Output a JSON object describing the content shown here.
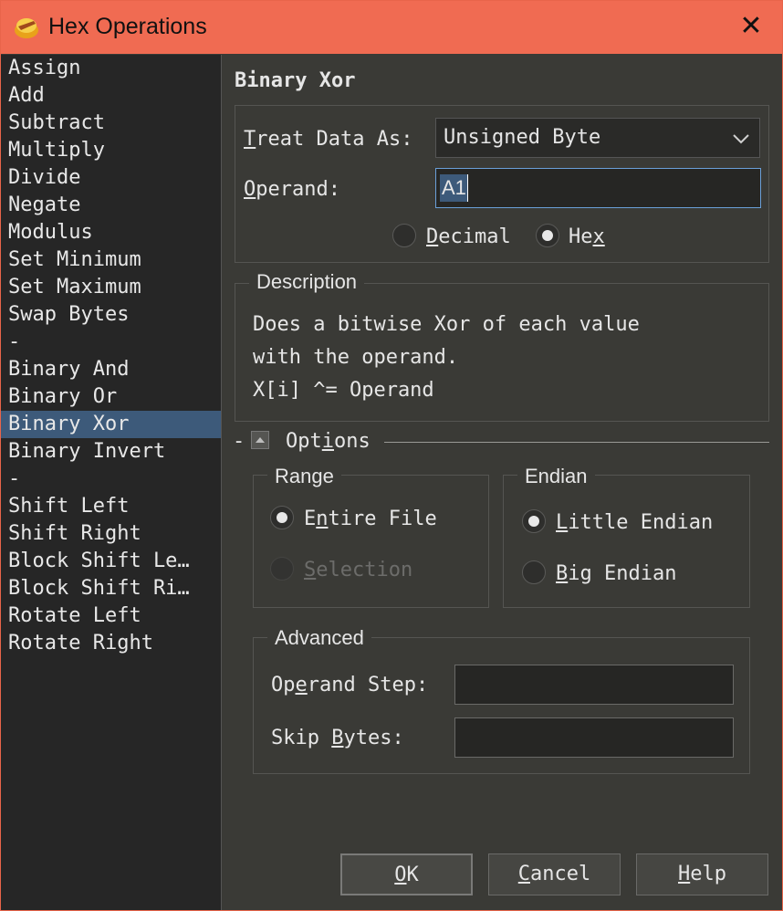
{
  "window": {
    "title": "Hex Operations",
    "close_glyph": "✕"
  },
  "operations": [
    "Assign",
    "Add",
    "Subtract",
    "Multiply",
    "Divide",
    "Negate",
    "Modulus",
    "Set Minimum",
    "Set Maximum",
    "Swap Bytes",
    "-",
    "Binary And",
    "Binary Or",
    "Binary Xor",
    "Binary Invert",
    "-",
    "Shift Left",
    "Shift Right",
    "Block Shift Le…",
    "Block Shift Ri…",
    "Rotate Left",
    "Rotate Right"
  ],
  "selected_index": 13,
  "panel": {
    "heading": "Binary Xor",
    "treat_label_u": "T",
    "treat_label_rest": "reat Data As:",
    "treat_value": "Unsigned Byte",
    "operand_label_u": "O",
    "operand_label_rest": "perand:",
    "operand_value": "A1",
    "radix": {
      "decimal_u": "D",
      "decimal_rest": "ecimal",
      "hex_a": "He",
      "hex_u": "x",
      "selected": "Hex"
    }
  },
  "description": {
    "legend": "Description",
    "line1": "Does a bitwise Xor of each value",
    "line2": "with the operand.",
    "line3": "X[i] ^= Operand"
  },
  "options": {
    "dash": "-",
    "label_a": "Opt",
    "label_u": "i",
    "label_rest": "ons",
    "range": {
      "legend": "Range",
      "entire_a": "E",
      "entire_u": "n",
      "entire_rest": "tire File",
      "selection_u": "S",
      "selection_rest": "election",
      "selected": "Entire File"
    },
    "endian": {
      "legend": "Endian",
      "little_u": "L",
      "little_rest": "ittle Endian",
      "big_u": "B",
      "big_rest": "ig Endian",
      "selected": "Little Endian"
    },
    "advanced": {
      "legend": "Advanced",
      "step_a": "Op",
      "step_u": "e",
      "step_rest": "rand Step:",
      "skip_a": "Skip ",
      "skip_u": "B",
      "skip_rest": "ytes:",
      "step_value": "",
      "skip_value": ""
    }
  },
  "buttons": {
    "ok_u": "O",
    "ok_rest": "K",
    "cancel_u": "C",
    "cancel_rest": "ancel",
    "help_u": "H",
    "help_rest": "elp"
  }
}
